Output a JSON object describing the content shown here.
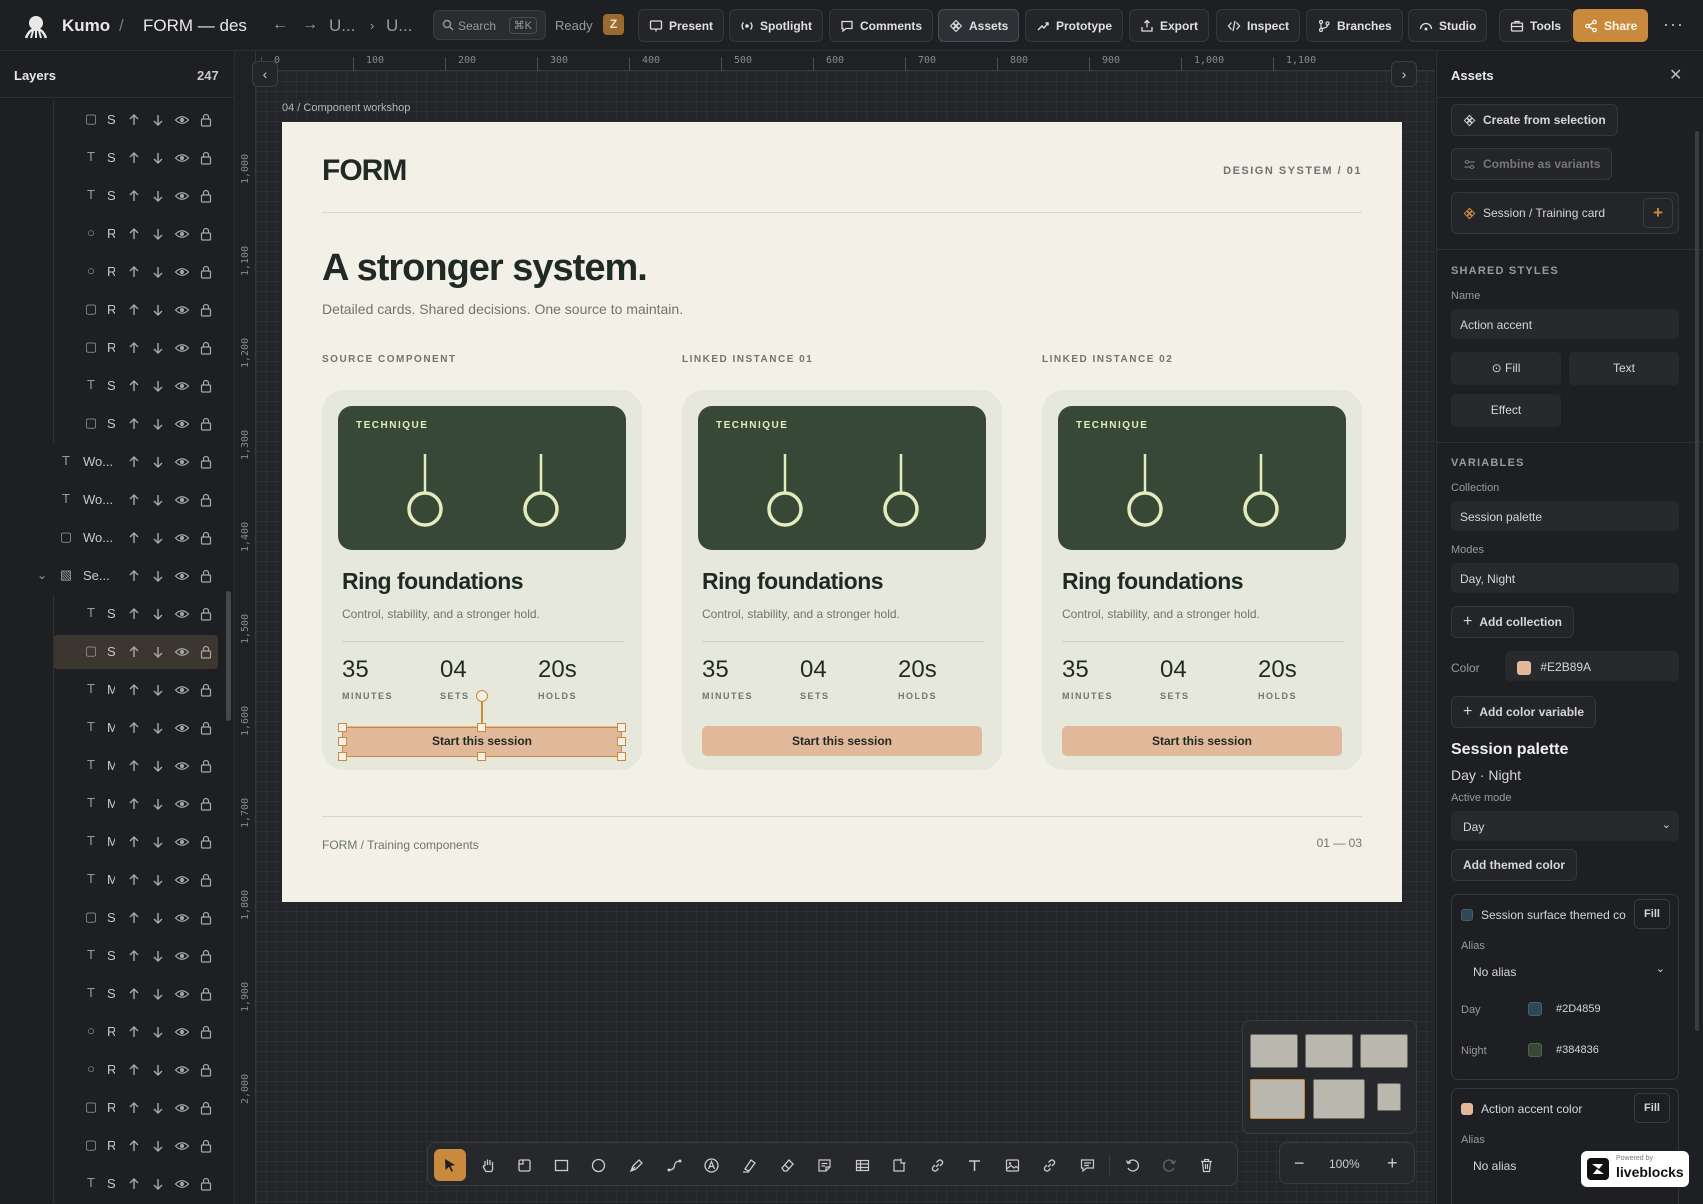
{
  "app": {
    "name": "Kumo",
    "file_title": "FORM — desi",
    "breadcrumb": [
      "U...",
      "U..."
    ],
    "status": "Ready",
    "user_initial": "Z"
  },
  "search": {
    "placeholder": "Search",
    "shortcut": "⌘K"
  },
  "toolbar_top": [
    {
      "label": "Present",
      "icon": "present-icon"
    },
    {
      "label": "Spotlight",
      "icon": "spotlight-icon"
    },
    {
      "label": "Comments",
      "icon": "comment-icon"
    },
    {
      "label": "Assets",
      "icon": "component-icon",
      "active": true
    },
    {
      "label": "Prototype",
      "icon": "prototype-icon"
    },
    {
      "label": "Export",
      "icon": "export-icon"
    },
    {
      "label": "Inspect",
      "icon": "code-icon"
    },
    {
      "label": "Branches",
      "icon": "branch-icon"
    },
    {
      "label": "Studio",
      "icon": "studio-icon"
    },
    {
      "label": "Tools",
      "icon": "tools-icon"
    },
    {
      "label": "Share",
      "icon": "share-icon",
      "primary": true
    }
  ],
  "layers": {
    "title": "Layers",
    "count": "247",
    "rows": [
      {
        "type": "rect",
        "name": "S",
        "indent": 2
      },
      {
        "type": "text",
        "name": "S",
        "indent": 2
      },
      {
        "type": "text",
        "name": "S",
        "indent": 2
      },
      {
        "type": "ellipse",
        "name": "R",
        "indent": 2
      },
      {
        "type": "ellipse",
        "name": "R",
        "indent": 2
      },
      {
        "type": "rect",
        "name": "R",
        "indent": 2
      },
      {
        "type": "rect",
        "name": "R",
        "indent": 2
      },
      {
        "type": "text",
        "name": "S",
        "indent": 2
      },
      {
        "type": "rect",
        "name": "S",
        "indent": 2
      },
      {
        "type": "text",
        "name": "Wo...",
        "indent": 1
      },
      {
        "type": "text",
        "name": "Wo...",
        "indent": 1
      },
      {
        "type": "rect",
        "name": "Wo...",
        "indent": 1
      },
      {
        "type": "frame",
        "name": "Se...",
        "indent": 1,
        "expanded": true
      },
      {
        "type": "text",
        "name": "S",
        "indent": 2
      },
      {
        "type": "rect",
        "name": "S",
        "indent": 2,
        "selected": true
      },
      {
        "type": "text",
        "name": "M",
        "indent": 2
      },
      {
        "type": "text",
        "name": "M",
        "indent": 2
      },
      {
        "type": "text",
        "name": "M",
        "indent": 2
      },
      {
        "type": "text",
        "name": "M",
        "indent": 2
      },
      {
        "type": "text",
        "name": "M",
        "indent": 2
      },
      {
        "type": "text",
        "name": "M",
        "indent": 2
      },
      {
        "type": "rect",
        "name": "S",
        "indent": 2
      },
      {
        "type": "text",
        "name": "S",
        "indent": 2
      },
      {
        "type": "text",
        "name": "S",
        "indent": 2
      },
      {
        "type": "ellipse",
        "name": "R",
        "indent": 2
      },
      {
        "type": "ellipse",
        "name": "R",
        "indent": 2
      },
      {
        "type": "rect",
        "name": "R",
        "indent": 2
      },
      {
        "type": "rect",
        "name": "R",
        "indent": 2
      },
      {
        "type": "text",
        "name": "S",
        "indent": 2
      }
    ]
  },
  "rulers": {
    "top": [
      "0",
      "100",
      "200",
      "300",
      "400",
      "500",
      "600",
      "700",
      "800",
      "900",
      "1,000",
      "1,100"
    ],
    "left": [
      "1,000",
      "1,100",
      "1,200",
      "1,300",
      "1,400",
      "1,500",
      "1,600",
      "1,700",
      "1,800",
      "1,900",
      "2,000"
    ]
  },
  "canvas": {
    "frame_label": "04 / Component workshop",
    "frame": {
      "logo": "FORM",
      "tagline": "DESIGN SYSTEM / 01",
      "headline": "A stronger system.",
      "subhead": "Detailed cards. Shared decisions. One source to maintain.",
      "columns": [
        "SOURCE COMPONENT",
        "LINKED INSTANCE 01",
        "LINKED INSTANCE 02"
      ],
      "card": {
        "tag": "TECHNIQUE",
        "title": "Ring foundations",
        "description": "Control, stability, and a stronger hold.",
        "stats": [
          {
            "value": "35",
            "label": "MINUTES"
          },
          {
            "value": "04",
            "label": "SETS"
          },
          {
            "value": "20s",
            "label": "HOLDS"
          }
        ],
        "button": "Start this session"
      },
      "footer_left": "FORM / Training components",
      "footer_right": "01 — 03"
    },
    "zoom": "100%"
  },
  "colors": {
    "accent": "#C98A3E",
    "card_hero": "#384836",
    "ring": "#E2ECBF",
    "button": "#E2B89A",
    "frame_bg": "#F3F0E7"
  },
  "assets_panel": {
    "title": "Assets",
    "create_from_selection": "Create from selection",
    "combine_as_variants": "Combine as variants",
    "component_name": "Session / Training card",
    "shared_styles": {
      "heading": "SHARED STYLES",
      "name_label": "Name",
      "name_value": "Action accent",
      "tabs": [
        "Fill",
        "Text",
        "Effect"
      ]
    },
    "variables": {
      "heading": "VARIABLES",
      "collection_label": "Collection",
      "collection_value": "Session palette",
      "modes_label": "Modes",
      "modes_value": "Day, Night",
      "add_collection": "Add collection",
      "color_label": "Color",
      "color_value": "#E2B89A",
      "add_color_variable": "Add color variable"
    },
    "palette": {
      "title": "Session palette",
      "modes": "Day · Night",
      "active_mode_label": "Active mode",
      "active_mode_value": "Day",
      "add_themed_color": "Add themed color"
    },
    "themed_colors": [
      {
        "name": "Session surface themed col",
        "kind": "Fill",
        "alias_label": "Alias",
        "alias_value": "No alias",
        "day_label": "Day",
        "day": "#2D4859",
        "night_label": "Night",
        "night": "#384836",
        "swatch": "#2D4859"
      },
      {
        "name": "Action accent color",
        "kind": "Fill",
        "alias_label": "Alias",
        "alias_value": "No alias",
        "swatch": "#E2B89A"
      }
    ]
  },
  "badge": {
    "small": "Powered by",
    "brand": "liveblocks"
  }
}
